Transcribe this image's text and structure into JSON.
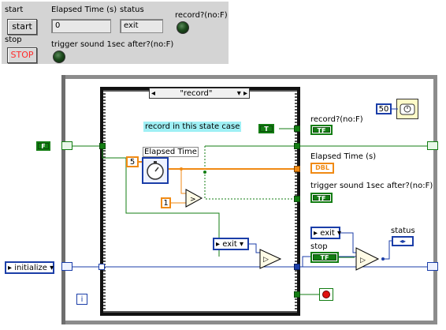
{
  "front_panel": {
    "start_label": "start",
    "start_button": "start",
    "stop_label": "stop",
    "stop_button": "STOP",
    "elapsed_label": "Elapsed Time (s)",
    "elapsed_value": "0",
    "status_label": "status",
    "status_value": "exit",
    "record_label": "record?(no:F)",
    "trigger_label": "trigger sound 1sec after?(no:F)"
  },
  "diagram": {
    "case_selector": "\"record\"",
    "comment": "record in this state case",
    "record_indicator_label": "record?(no:F)",
    "elapsed_indicator_label": "Elapsed Time (s)",
    "trigger_indicator_label": "trigger sound 1sec after?(no:F)",
    "elapsed_express_label": "Elapsed Time",
    "const_5": "5",
    "const_1": "1",
    "const_50": "50",
    "const_F": "F",
    "const_T": "T",
    "initialize_enum": "initialize",
    "exit_enum_inner": "exit",
    "exit_enum_outer": "exit",
    "stop_label": "stop",
    "status_label": "status",
    "tf": "TF",
    "dbl": "DBL",
    "iteration": "i",
    "enum_term": "◂▸"
  },
  "colors": {
    "boolean": "#137d13",
    "numeric": "#f08a14",
    "enum": "#1b3ea8",
    "loop_frame": "#8c8c8c",
    "stop_text": "#ff2b2b"
  }
}
